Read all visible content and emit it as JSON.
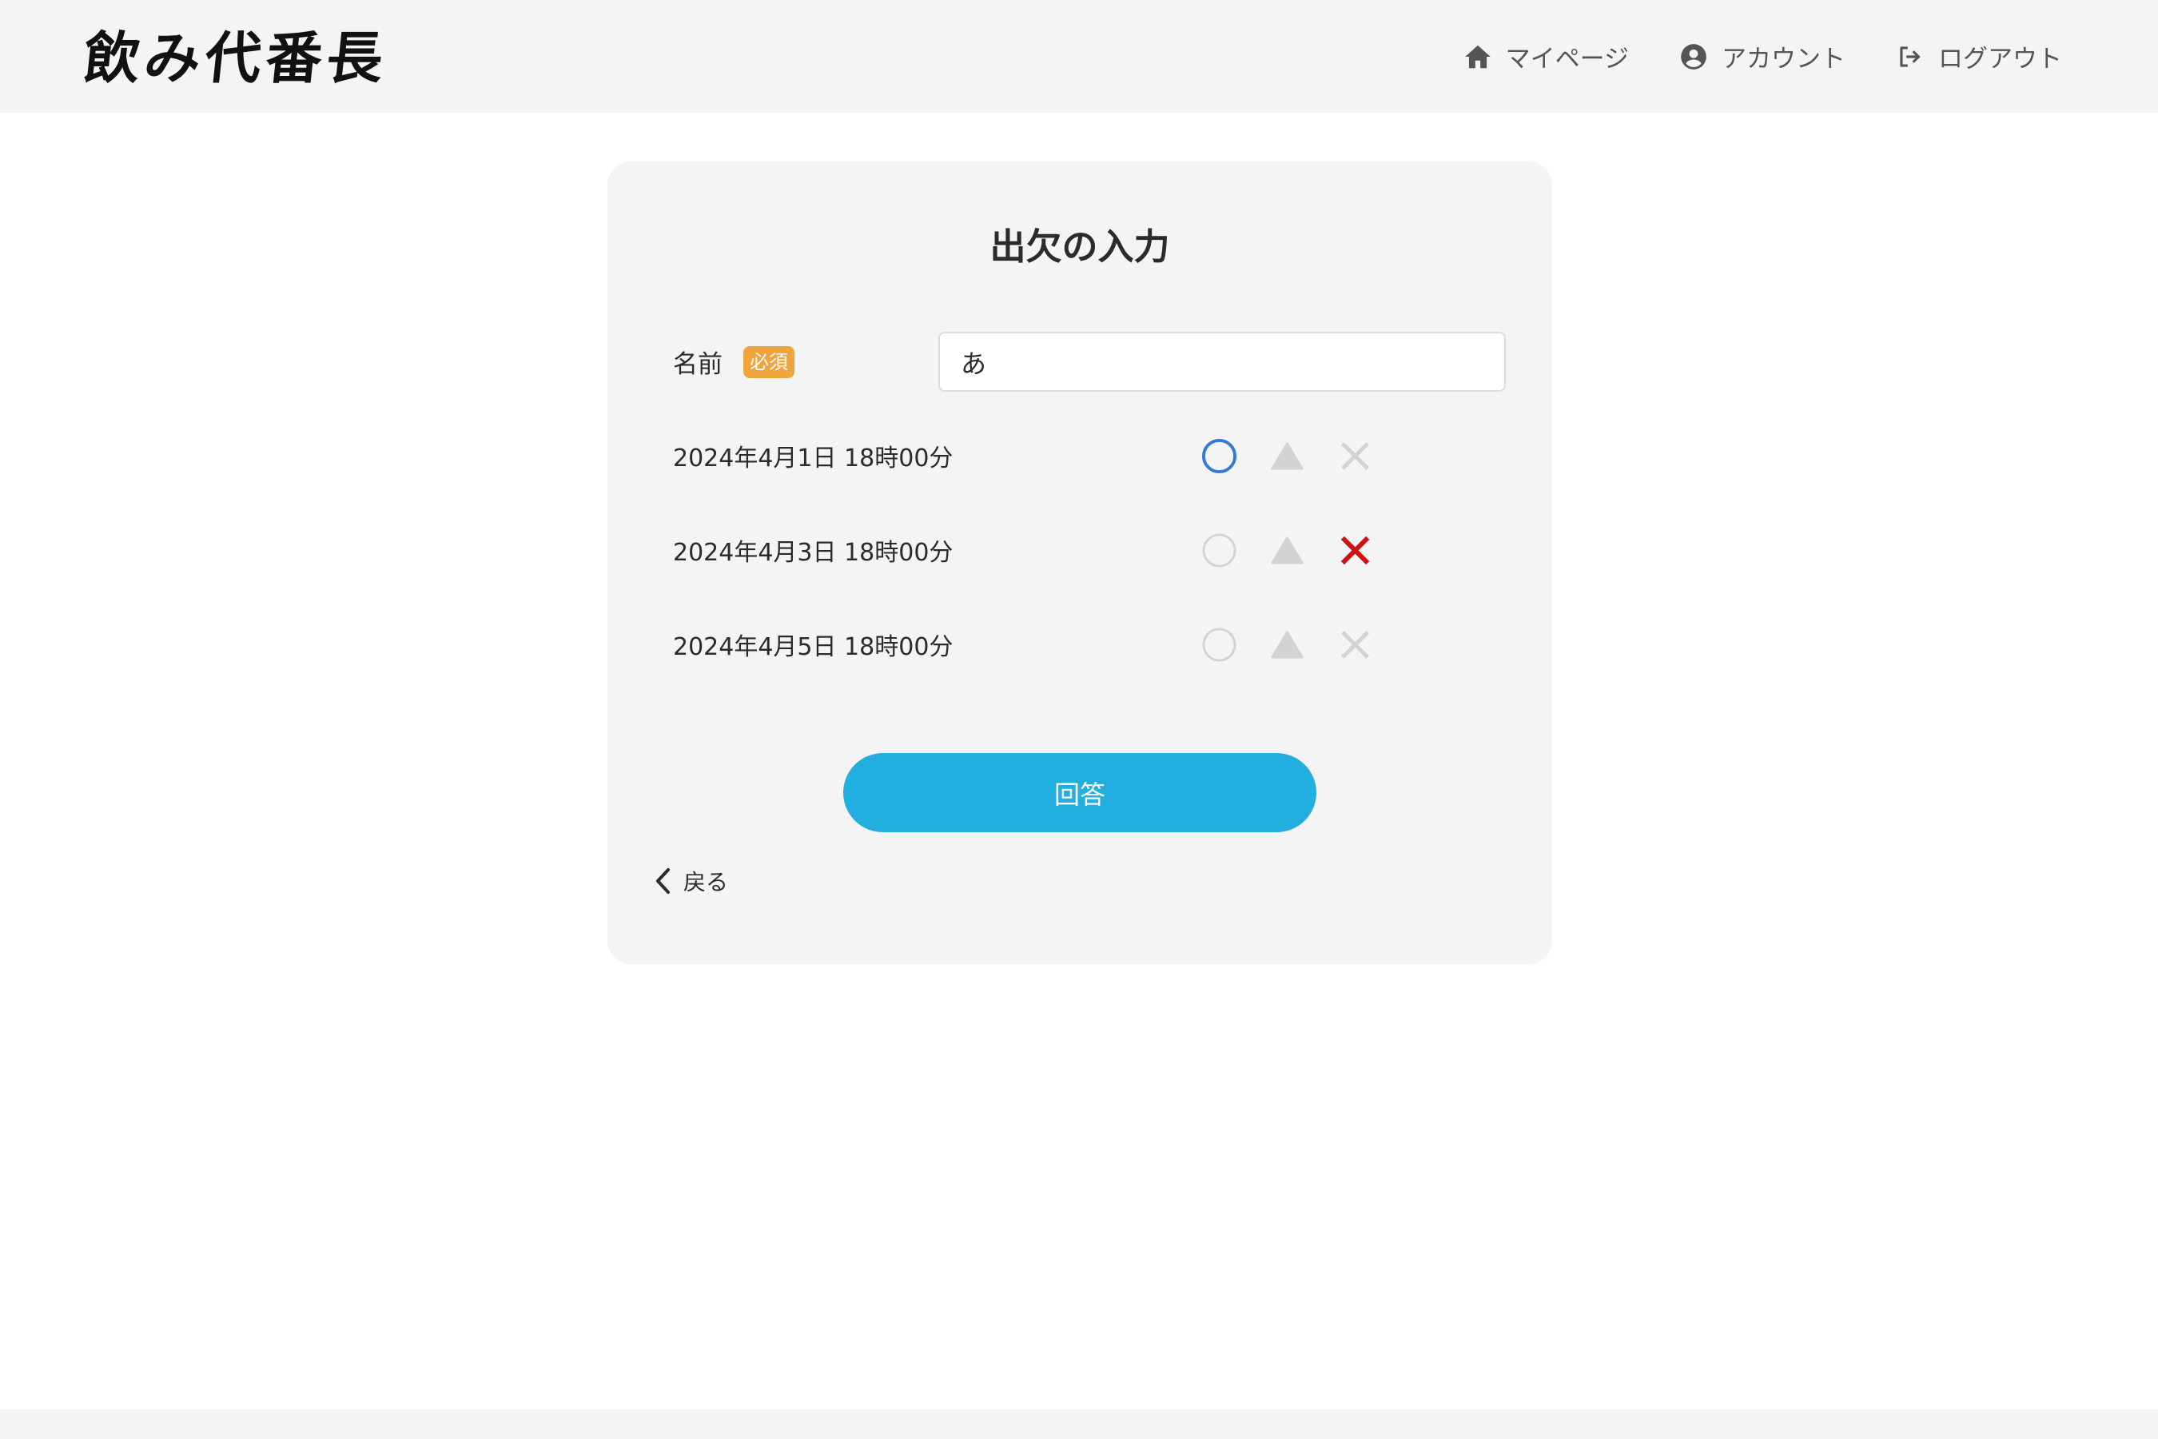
{
  "header": {
    "logo": "飲み代番長",
    "nav": [
      {
        "label": "マイページ",
        "icon": "home-icon"
      },
      {
        "label": "アカウント",
        "icon": "user-circle-icon"
      },
      {
        "label": "ログアウト",
        "icon": "logout-icon"
      }
    ]
  },
  "form": {
    "title": "出欠の入力",
    "name_label": "名前",
    "required_badge": "必須",
    "name_value": "あ",
    "dates": [
      {
        "label": "2024年4月1日 18時00分",
        "selected": "circle"
      },
      {
        "label": "2024年4月3日 18時00分",
        "selected": "cross"
      },
      {
        "label": "2024年4月5日 18時00分",
        "selected": "none"
      }
    ],
    "submit_label": "回答",
    "back_label": "戻る"
  },
  "colors": {
    "selected_circle": "#2f7bd6",
    "selected_cross": "#d01212",
    "unselected": "#d3d3d3",
    "submit_button": "#23aee0",
    "badge": "#f0a53c"
  }
}
